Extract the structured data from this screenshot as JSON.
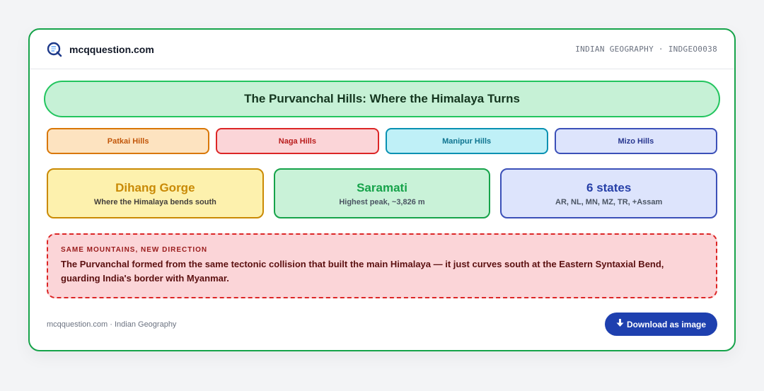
{
  "header": {
    "brand": "mcqquestion.com",
    "meta": "INDIAN GEOGRAPHY · INDGEO0038"
  },
  "title": "The Purvanchal Hills: Where the Himalaya Turns",
  "chips": [
    "Patkai Hills",
    "Naga Hills",
    "Manipur Hills",
    "Mizo Hills"
  ],
  "stats": [
    {
      "value": "Dihang Gorge",
      "caption": "Where the Himalaya bends south"
    },
    {
      "value": "Saramati",
      "caption": "Highest peak, ~3,826 m"
    },
    {
      "value": "6 states",
      "caption": "AR, NL, MN, MZ, TR, +Assam"
    }
  ],
  "note": {
    "heading": "SAME MOUNTAINS, NEW DIRECTION",
    "body": "The Purvanchal formed from the same tectonic collision that built the main Himalaya — it just curves south at the Eastern Syntaxial Bend, guarding India's border with Myanmar."
  },
  "footer": {
    "text": "mcqquestion.com · Indian Geography",
    "download_label": "Download as image",
    "download_icon": "download-arrow-icon"
  },
  "colors": {
    "accent_green": "#16a34a",
    "download_blue": "#1e40af",
    "note_red": "#dc2626"
  }
}
